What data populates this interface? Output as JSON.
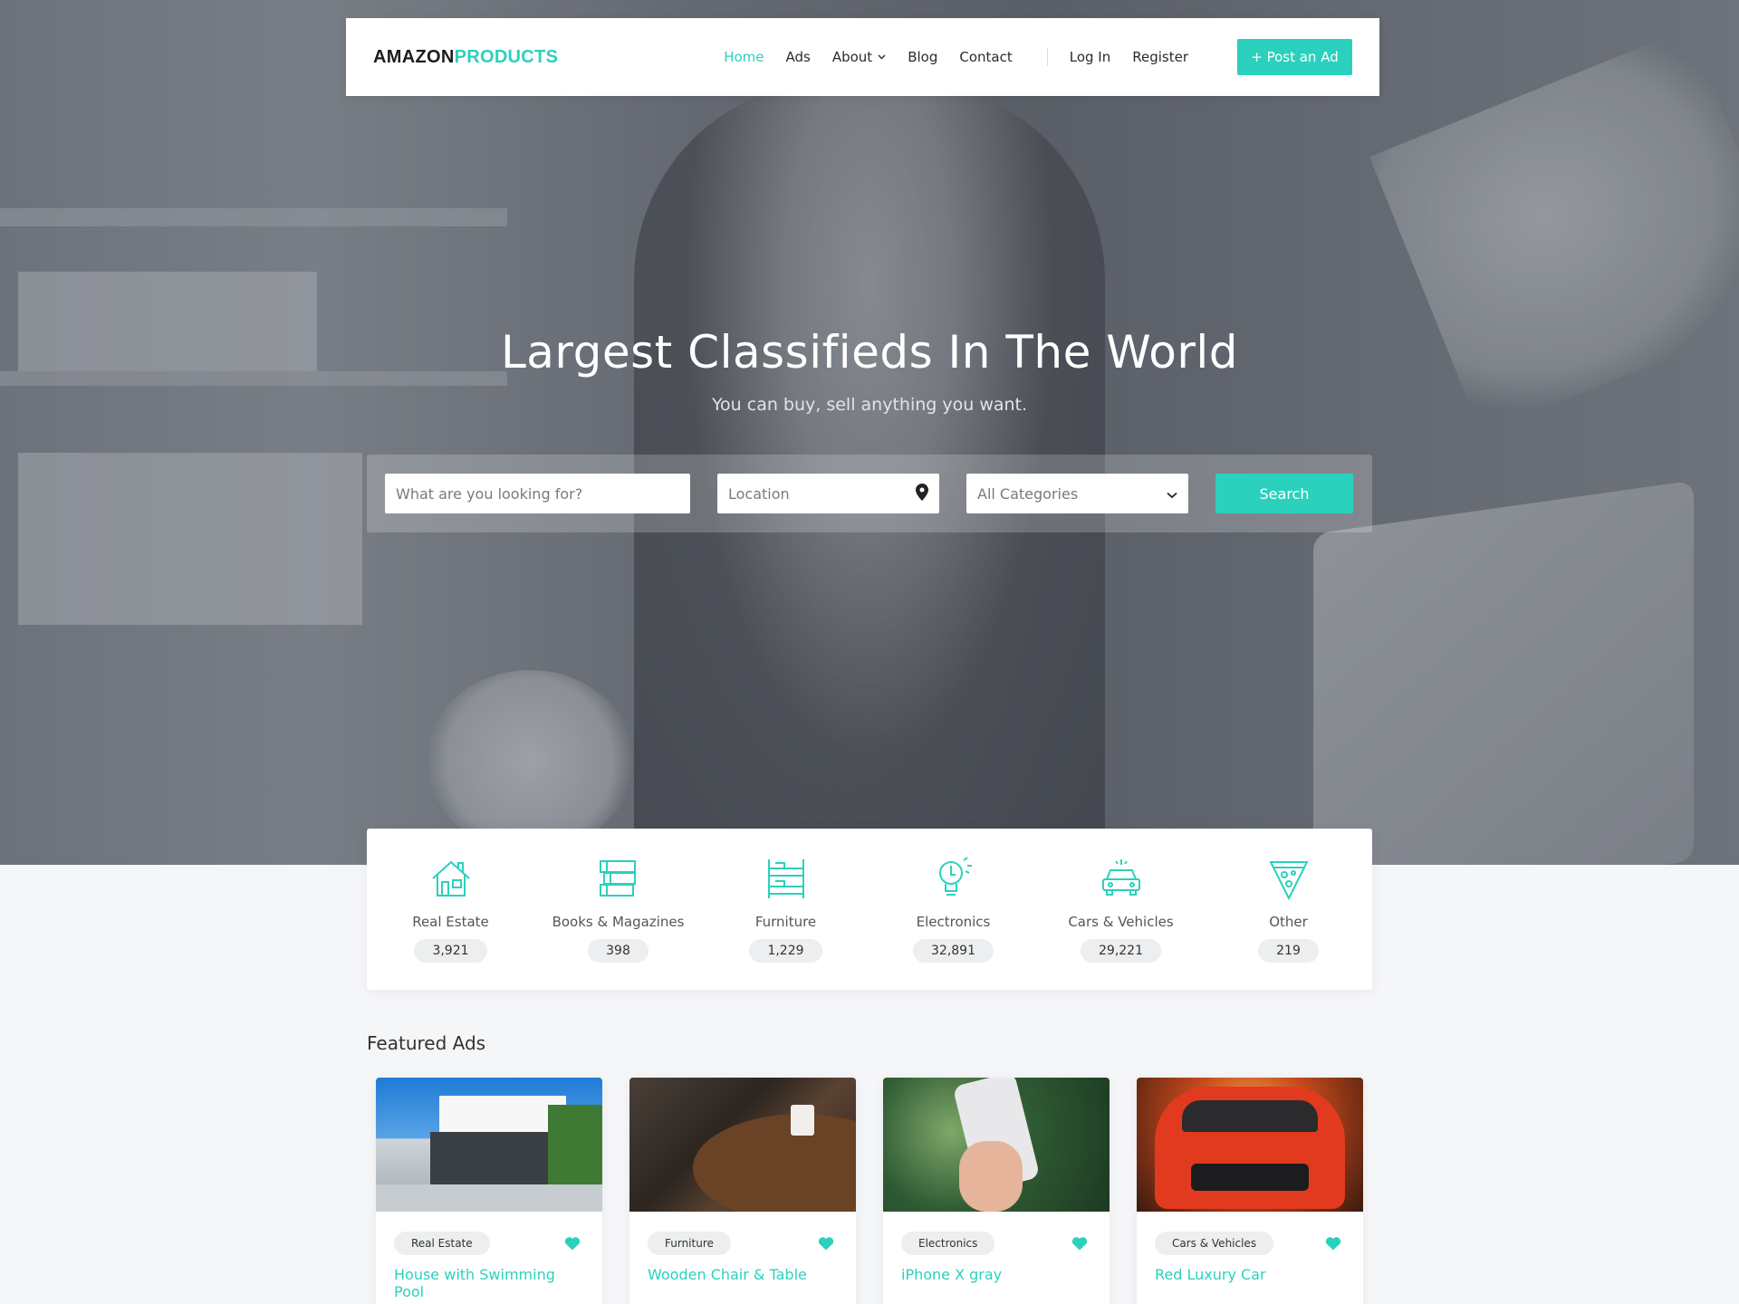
{
  "brand": {
    "part1": "AMAZON",
    "part2": "PRODUCTS"
  },
  "nav": {
    "items": [
      {
        "label": "Home",
        "active": true
      },
      {
        "label": "Ads",
        "active": false
      },
      {
        "label": "About",
        "active": false,
        "dropdown": true
      },
      {
        "label": "Blog",
        "active": false
      },
      {
        "label": "Contact",
        "active": false
      }
    ],
    "login": "Log In",
    "register": "Register",
    "post_ad": "+ Post an Ad"
  },
  "hero": {
    "title": "Largest Classifieds In The World",
    "subtitle": "You can buy, sell anything you want."
  },
  "search": {
    "what_placeholder": "What are you looking for?",
    "location_placeholder": "Location",
    "category_selected": "All Categories",
    "button": "Search"
  },
  "categories": [
    {
      "label": "Real Estate",
      "count": "3,921",
      "icon": "house-icon"
    },
    {
      "label": "Books & Magazines",
      "count": "398",
      "icon": "books-icon"
    },
    {
      "label": "Furniture",
      "count": "1,229",
      "icon": "bunk-bed-icon"
    },
    {
      "label": "Electronics",
      "count": "32,891",
      "icon": "lightbulb-icon"
    },
    {
      "label": "Cars & Vehicles",
      "count": "29,221",
      "icon": "car-icon"
    },
    {
      "label": "Other",
      "count": "219",
      "icon": "pizza-icon"
    }
  ],
  "featured": {
    "title": "Featured Ads",
    "ads": [
      {
        "category": "Real Estate",
        "title": "House with Swimming Pool"
      },
      {
        "category": "Furniture",
        "title": "Wooden Chair & Table"
      },
      {
        "category": "Electronics",
        "title": "iPhone X gray"
      },
      {
        "category": "Cars & Vehicles",
        "title": "Red Luxury Car"
      }
    ]
  },
  "colors": {
    "accent": "#2bd1bd",
    "text": "#333333",
    "count_bg": "#eceef0"
  }
}
